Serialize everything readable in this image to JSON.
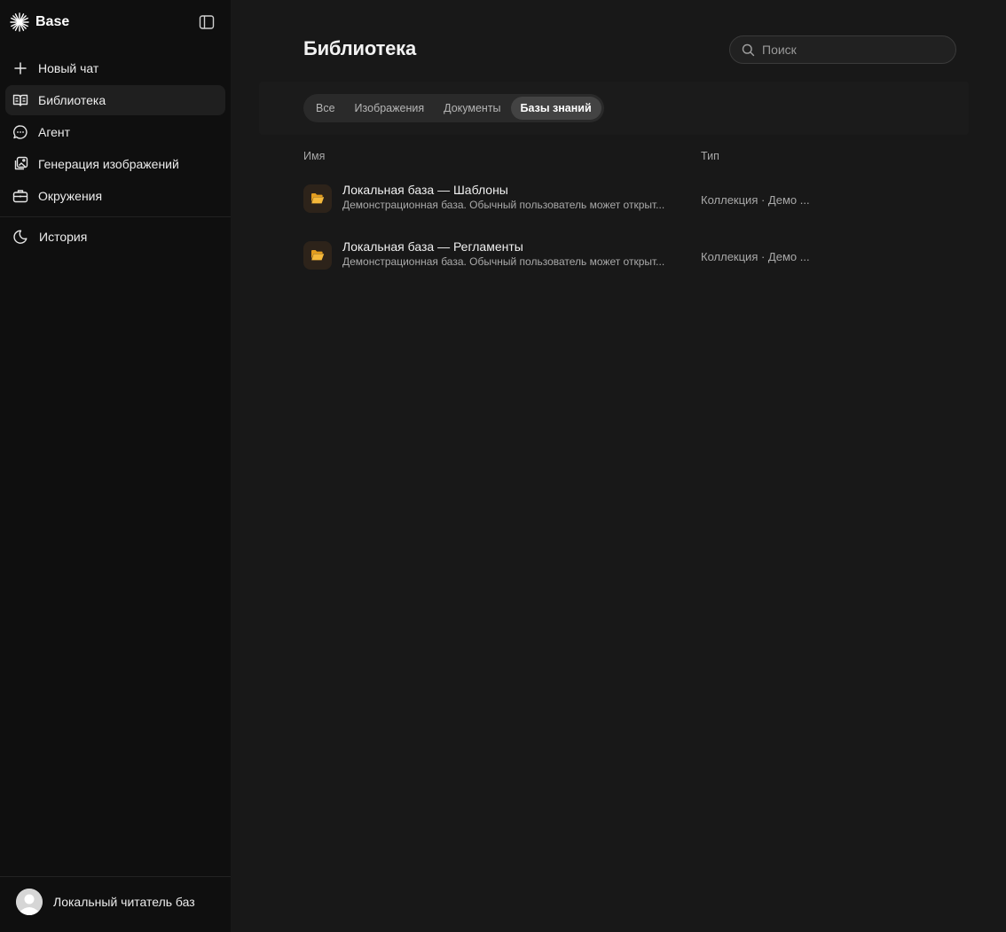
{
  "app": {
    "name": "Base"
  },
  "sidebar": {
    "items": [
      {
        "label": "Новый чат",
        "icon": "plus-icon",
        "active": false
      },
      {
        "label": "Библиотека",
        "icon": "book-open-icon",
        "active": true
      },
      {
        "label": "Агент",
        "icon": "chat-bubble-icon",
        "active": false
      },
      {
        "label": "Генерация изображений",
        "icon": "image-edit-icon",
        "active": false
      },
      {
        "label": "Окружения",
        "icon": "briefcase-icon",
        "active": false
      }
    ],
    "history_label": "История",
    "user_name": "Локальный читатель баз"
  },
  "header": {
    "title": "Библиотека",
    "search_placeholder": "Поиск"
  },
  "tabs": [
    {
      "label": "Все",
      "active": false
    },
    {
      "label": "Изображения",
      "active": false
    },
    {
      "label": "Документы",
      "active": false
    },
    {
      "label": "Базы знаний",
      "active": true
    }
  ],
  "table": {
    "columns": {
      "name": "Имя",
      "type": "Тип"
    },
    "rows": [
      {
        "title": "Локальная база — Шаблоны",
        "description": "Демонстрационная база. Обычный пользователь может открыт...",
        "type": "Коллекция · Демо ...",
        "icon": "folder-open-icon"
      },
      {
        "title": "Локальная база — Регламенты",
        "description": "Демонстрационная база. Обычный пользователь может открыт...",
        "type": "Коллекция · Демо ...",
        "icon": "folder-open-icon"
      }
    ]
  },
  "colors": {
    "sidebar_bg": "#0f0f0f",
    "main_bg": "#181818",
    "folder_accent": "#f2b33a"
  }
}
